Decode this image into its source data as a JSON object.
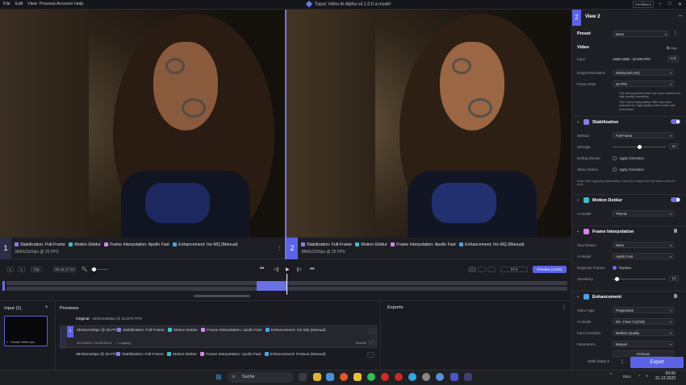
{
  "menubar": {
    "items": [
      "File",
      "Edit",
      "View",
      "Process",
      "Account",
      "Help"
    ],
    "title": "Topaz Video AI Alpha  v4.1.0.0.a.model",
    "feedback": "Feedback"
  },
  "previews": {
    "left": {
      "num": "1",
      "filters": [
        "Stabilization: Full-Frame",
        "Motion Deblur",
        "Frame Interpolation: Apollo Fast",
        "Enhancement: Iris MQ (Manual)"
      ],
      "res": "3840x2160px @ 25 FPS"
    },
    "right": {
      "num": "2",
      "filters": [
        "Stabilization: Full-Frame",
        "Motion Deblur",
        "Frame Interpolation: Apollo Fast",
        "Enhancement: Iris MQ (Manual)"
      ],
      "res": "3840x2160px @ 25 FPS"
    }
  },
  "transport": {
    "speed_1": "1",
    "speed_2": "1",
    "clip_btn": "Clip",
    "timecode": "00:16:27:18",
    "zoom": "Fit",
    "preview_btn": "Preview (1/10s)"
  },
  "bottom": {
    "input_title": "Input (1)",
    "input_caption": "1 - Fassilie Glöde mp4",
    "previews_title": "Previews",
    "original_label": "Original",
    "original_res": "1920x1080px @ 23.976 FPS",
    "row1": {
      "num": "3",
      "res": "3840x2160px @ 25 FPS",
      "filters": [
        "Stabilization: Full-Frame",
        "Motion Deblur",
        "Frame Interpolation: Apollo Fast",
        "Enhancement: Iris MQ (Manual)"
      ],
      "sub": "00:15:58.0 / 00:16:30.21",
      "loop": "Looping",
      "time": "0m/20s"
    },
    "row2": {
      "res": "3840x2160px @ 25 FPS",
      "filters": [
        "Stabilization: Full-Frame",
        "Motion Deblur",
        "Frame Interpolation: Apollo Fast",
        "Enhancement: Proteus (Manual)"
      ]
    },
    "exports_title": "Exports"
  },
  "panel": {
    "view_num": "2",
    "view_title": "View 2",
    "preset_label": "Preset",
    "preset_value": "None",
    "video_label": "Video",
    "crop_label": "Crop",
    "input_label": "Input",
    "input_value": "1920×1080 · 23.976 FPS",
    "edit_btn": "Edit",
    "outres_label": "Output Resolution",
    "outres_value": "3840x2160 (4K)",
    "fps_label": "Frame Rate",
    "fps_value": "25 FPS",
    "note1": "The Enhancement filter has been enabled for high-quality upscaling.",
    "note2": "The Frame Interpolation filter has been activated for high-quality video frame rate conversion.",
    "stab_title": "Stabilization",
    "method_label": "Method",
    "method_value": "Full-Frame",
    "strength_label": "Strength",
    "strength_value": "50",
    "rolling_label": "Rolling Shutter",
    "rolling_opt": "Apply Correction",
    "jittery_label": "Jittery Motion",
    "jittery_opt": "Apply Correction",
    "stab_note": "Note: After applying stabilization, input and output will not match pixel for pixel.",
    "deblur_title": "Motion Deblur",
    "deblur_model_label": "AI Model",
    "deblur_model_value": "Themis",
    "fi_title": "Frame Interpolation",
    "slow_label": "Slow Motion",
    "slow_value": "None",
    "fi_model_label": "AI Model",
    "fi_model_value": "Apollo Fast",
    "dup_label": "Duplicate Frames",
    "dup_opt": "Replace",
    "sens_label": "Sensitivity",
    "sens_value": "10",
    "enh_title": "Enhancement",
    "vtype_label": "Video Type",
    "vtype_value": "Progressive",
    "enh_model_label": "AI Model",
    "enh_model_value": "Iris - Face / LQ-MQ",
    "cond_label": "Input Condition",
    "cond_value": "Medium Quality",
    "params_label": "Parameters",
    "params_value": "Manual",
    "estimate": "Estimate",
    "codec": "H264 (mp4)",
    "export_btn": "Export"
  },
  "taskbar": {
    "search": "Suche",
    "lang": "DEU",
    "time": "09:55",
    "date": "31.12.2023"
  },
  "colors": {
    "accent": "#6a70e6",
    "stab": "#8a7ee8",
    "deblur": "#3cbfc9",
    "fi": "#d487e8",
    "enh": "#4aa3e8"
  }
}
